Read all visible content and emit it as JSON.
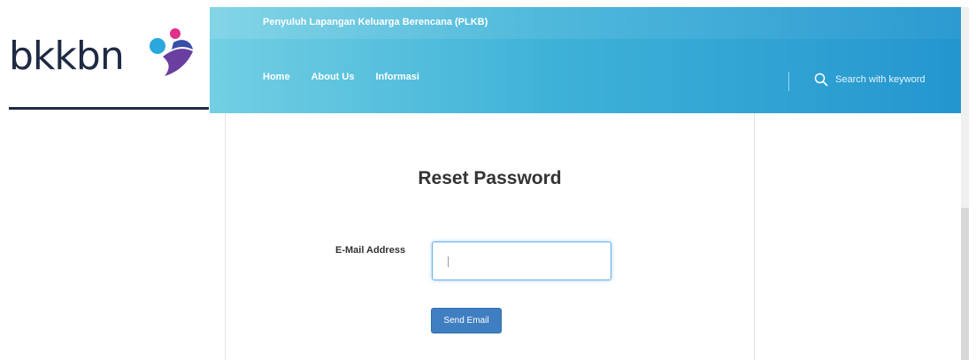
{
  "logo": {
    "text": "bkkbn",
    "colors": [
      "#1f2a44",
      "#2aa7dc",
      "#e0318a",
      "#6a3fa0"
    ]
  },
  "header": {
    "title": "Penyuluh Lapangan Keluarga Berencana (PLKB)"
  },
  "nav": {
    "items": [
      {
        "label": "Home"
      },
      {
        "label": "About Us"
      },
      {
        "label": "Informasi"
      }
    ]
  },
  "search": {
    "placeholder": "Search with keyword",
    "icon": "search-icon"
  },
  "main": {
    "title": "Reset Password",
    "email_label": "E-Mail Address",
    "email_value": "",
    "send_label": "Send Email"
  },
  "colors": {
    "header_start": "#72cfe3",
    "header_end": "#2496cf",
    "button": "#3f7fc1"
  }
}
